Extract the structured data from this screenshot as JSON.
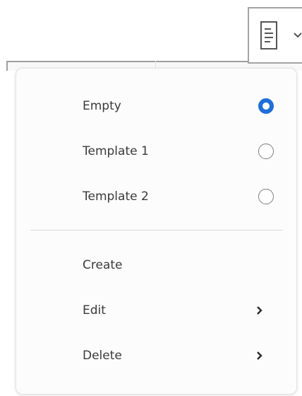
{
  "toolbar": {
    "trigger_icon": "document-icon",
    "dropdown_icon": "chevron-down-icon"
  },
  "menu": {
    "options": [
      {
        "label": "Empty",
        "selected": true
      },
      {
        "label": "Template 1",
        "selected": false
      },
      {
        "label": "Template 2",
        "selected": false
      }
    ],
    "actions": [
      {
        "label": "Create",
        "has_submenu": false
      },
      {
        "label": "Edit",
        "has_submenu": true
      },
      {
        "label": "Delete",
        "has_submenu": true
      }
    ]
  },
  "colors": {
    "accent": "#1f6fd8",
    "text": "#3a3a3a",
    "menu_background": "#fbfcfb"
  }
}
